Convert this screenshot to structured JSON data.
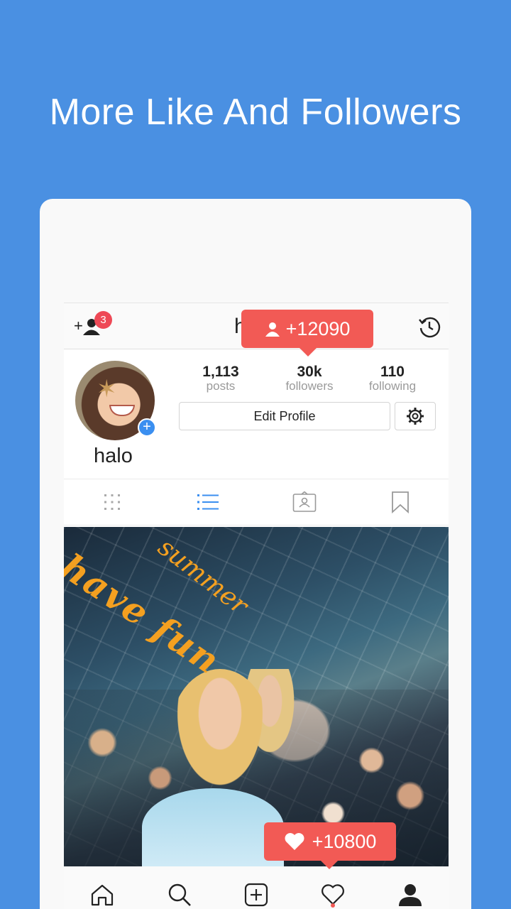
{
  "headline": "More Like And Followers",
  "colors": {
    "background": "#4a90e2",
    "accent": "#f25a55",
    "badge": "#ee4956",
    "tab_active": "#3b8ff0"
  },
  "topbar": {
    "badge_count": "3",
    "title_partial": "h",
    "left_icon": "add-user-icon",
    "right_icon": "history-icon"
  },
  "followers_bubble": {
    "text": "+12090",
    "icon": "person-icon"
  },
  "profile": {
    "name": "halo",
    "stats": [
      {
        "value": "1,113",
        "label": "posts"
      },
      {
        "value": "30k",
        "label": "followers"
      },
      {
        "value": "110",
        "label": "following"
      }
    ],
    "edit_label": "Edit Profile",
    "settings_icon": "gear-icon"
  },
  "tabs": [
    {
      "icon": "grid-icon",
      "active": false
    },
    {
      "icon": "list-icon",
      "active": true
    },
    {
      "icon": "tagged-icon",
      "active": false
    },
    {
      "icon": "bookmark-icon",
      "active": false
    }
  ],
  "photo": {
    "script_text_1": "have fun",
    "script_text_2": "summer"
  },
  "likes_bubble": {
    "text": "+10800",
    "icon": "heart-icon"
  },
  "bottom_nav": [
    "home-icon",
    "search-icon",
    "add-post-icon",
    "activity-heart-icon",
    "profile-icon"
  ]
}
